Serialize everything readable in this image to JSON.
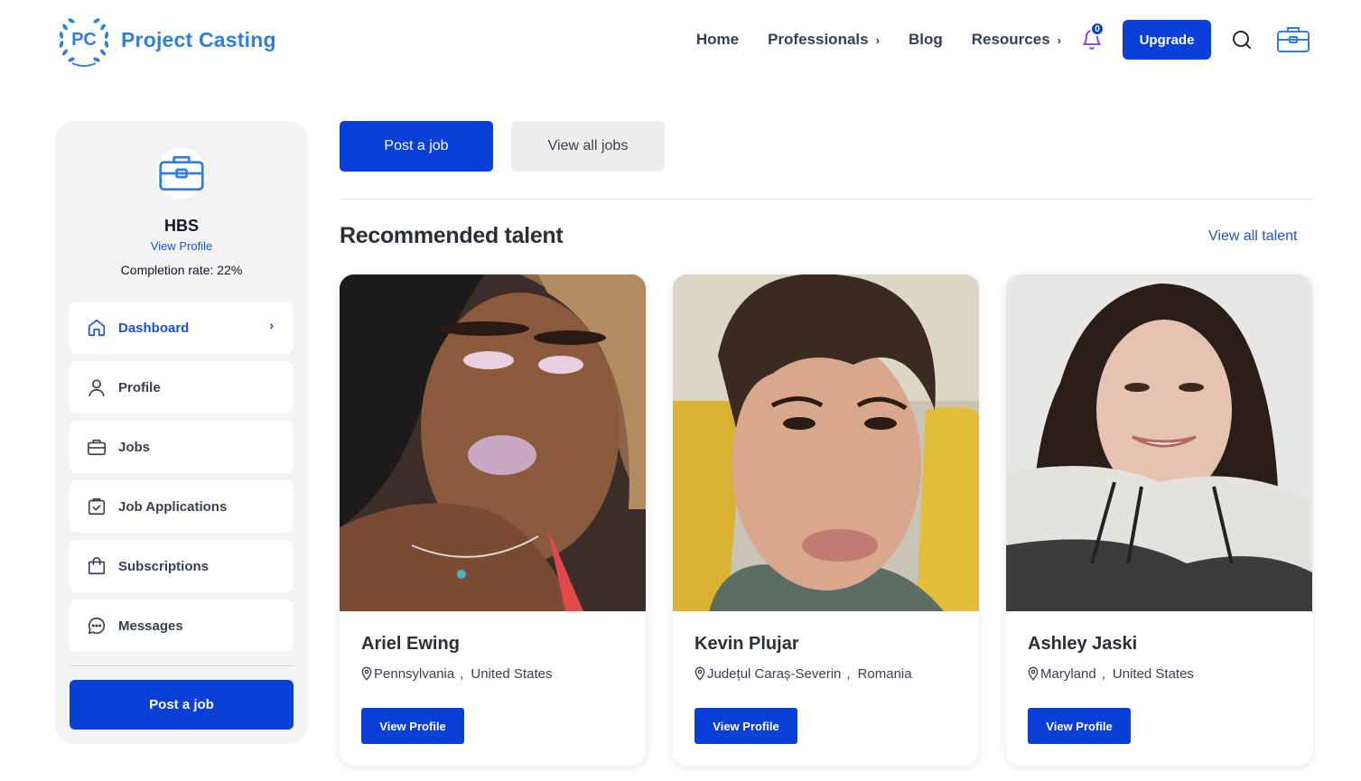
{
  "brand": {
    "logo_initials": "PC",
    "name": "Project Casting",
    "color": "#2f7fe0"
  },
  "nav": {
    "home": "Home",
    "professionals": "Professionals",
    "blog": "Blog",
    "resources": "Resources",
    "notification_count": "0",
    "upgrade": "Upgrade",
    "chevron": "›"
  },
  "sidebar": {
    "name": "HBS",
    "view_profile": "View Profile",
    "completion": "Completion rate: 22%",
    "items": [
      {
        "label": "Dashboard",
        "icon": "home-icon",
        "active": true
      },
      {
        "label": "Profile",
        "icon": "user-icon"
      },
      {
        "label": "Jobs",
        "icon": "briefcase-icon"
      },
      {
        "label": "Job Applications",
        "icon": "clipboard-check-icon"
      },
      {
        "label": "Subscriptions",
        "icon": "shopping-bag-icon"
      },
      {
        "label": "Messages",
        "icon": "chat-icon"
      }
    ],
    "active_chevron": "›",
    "post_job": "Post a job"
  },
  "main": {
    "post_job": "Post a job",
    "view_all_jobs": "View all jobs",
    "section_title": "Recommended talent",
    "view_all_talent": "View all talent",
    "talent": [
      {
        "name": "Ariel Ewing",
        "region": "Pennsylvania",
        "separator": ",",
        "country": "United States",
        "button": "View Profile"
      },
      {
        "name": "Kevin Plujar",
        "region": "Județul Caraș-Severin",
        "separator": ",",
        "country": "Romania",
        "button": "View Profile"
      },
      {
        "name": "Ashley Jaski",
        "region": "Maryland",
        "separator": ",",
        "country": "United States",
        "button": "View Profile"
      }
    ]
  },
  "colors": {
    "primary": "#0a3fd8",
    "link": "#1e55c9",
    "sidebar_bg": "#f3f3f3"
  }
}
